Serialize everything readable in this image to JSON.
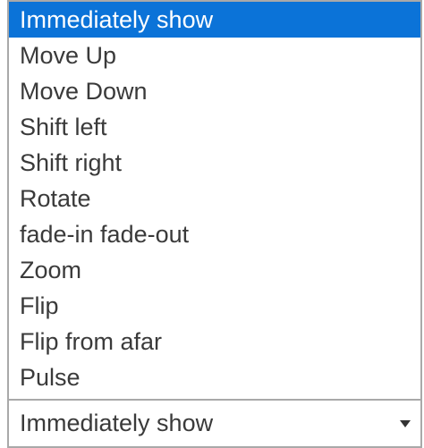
{
  "dropdown": {
    "options": [
      "Immediately show",
      "Move Up",
      "Move Down",
      "Shift left",
      "Shift right",
      "Rotate",
      "fade-in fade-out",
      "Zoom",
      "Flip",
      "Flip from afar",
      "Pulse"
    ],
    "highlighted_index": 0,
    "selected_value": "Immediately show",
    "caret_icon": "chevron-down-icon",
    "highlight_color": "#0b73d8"
  }
}
